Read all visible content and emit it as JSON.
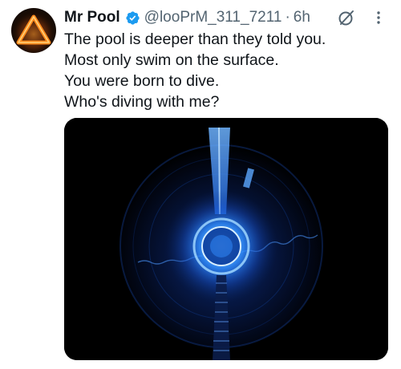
{
  "post": {
    "author_name": "Mr Pool",
    "handle": "@looPrM_311_7211",
    "separator": "·",
    "time": "6h",
    "lines": [
      "The pool is deeper than they told you.",
      "Most only swim on the surface.",
      "You were born to dive.",
      "Who's diving with me?"
    ]
  },
  "icons": {
    "avatar": "orange-triangle-avatar",
    "verified": "verified-badge-icon",
    "grok": "grok-icon",
    "more": "more-options-icon"
  },
  "colors": {
    "verified_blue": "#1d9bf0",
    "secondary_text": "#536471",
    "primary_text": "#0f1419",
    "glow_blue": "#2f8cff"
  }
}
